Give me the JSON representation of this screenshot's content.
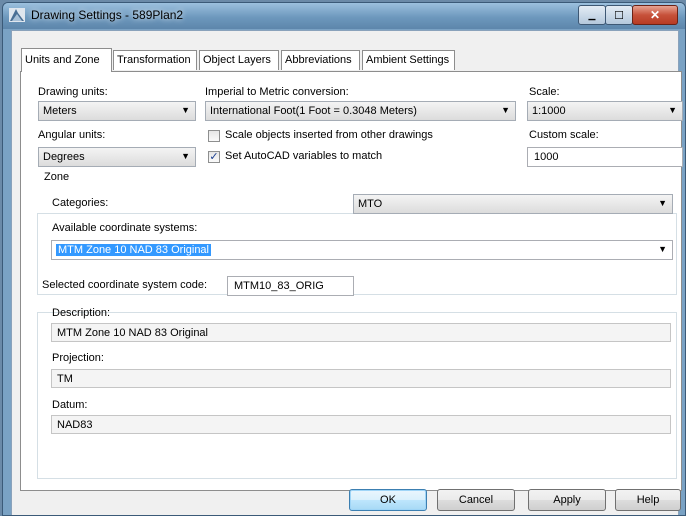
{
  "window": {
    "title": "Drawing Settings - 589Plan2",
    "minimize_glyph": "▁",
    "maximize_glyph": "☐",
    "close_glyph": "✕"
  },
  "tabs": [
    {
      "label": "Units and Zone",
      "active": true
    },
    {
      "label": "Transformation",
      "active": false
    },
    {
      "label": "Object Layers",
      "active": false
    },
    {
      "label": "Abbreviations",
      "active": false
    },
    {
      "label": "Ambient Settings",
      "active": false
    }
  ],
  "units": {
    "drawing_units_label": "Drawing units:",
    "drawing_units_value": "Meters",
    "conversion_label": "Imperial to Metric conversion:",
    "conversion_value": "International Foot(1 Foot = 0.3048 Meters)",
    "scale_label": "Scale:",
    "scale_value": "1:1000",
    "angular_units_label": "Angular units:",
    "angular_units_value": "Degrees",
    "scale_objects_label": "Scale objects inserted from other drawings",
    "scale_objects_checked": false,
    "set_variables_label": "Set AutoCAD variables to match",
    "set_variables_checked": true,
    "custom_scale_label": "Custom scale:",
    "custom_scale_value": "1000",
    "check_glyph": "✓"
  },
  "zone": {
    "group_label": "Zone",
    "categories_label": "Categories:",
    "categories_value": "MTO",
    "available_label": "Available coordinate systems:",
    "available_value": "MTM Zone 10 NAD 83 Original",
    "selected_code_label": "Selected coordinate system code:",
    "selected_code_value": "MTM10_83_ORIG",
    "description_label": "Description:",
    "description_value": "MTM Zone 10 NAD 83 Original",
    "projection_label": "Projection:",
    "projection_value": "TM",
    "datum_label": "Datum:",
    "datum_value": "NAD83"
  },
  "buttons": {
    "ok": "OK",
    "cancel": "Cancel",
    "apply": "Apply",
    "help": "Help"
  },
  "dropdown_arrow": "▼"
}
